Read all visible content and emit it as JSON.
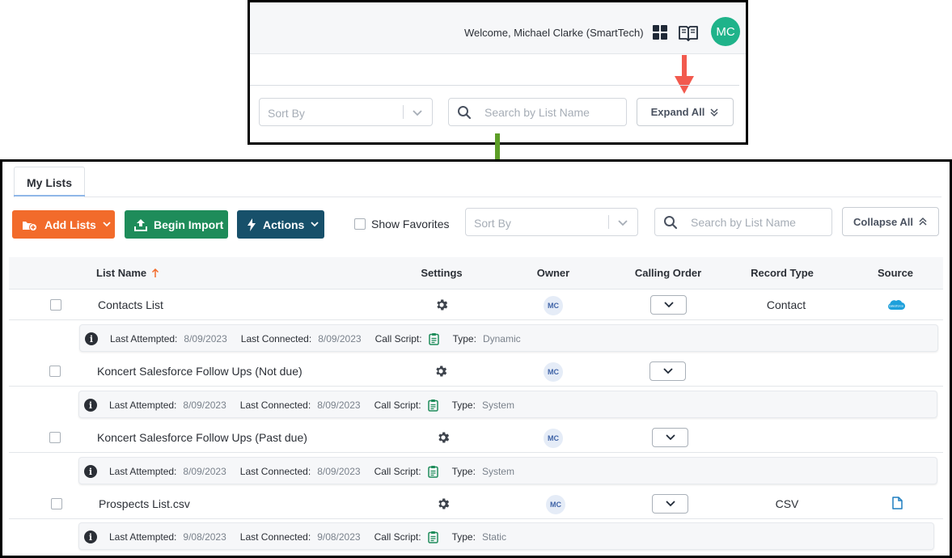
{
  "inset": {
    "welcome_text": "Welcome, Michael Clarke (SmartTech)",
    "avatar_initials": "MC",
    "sort_placeholder": "Sort By",
    "search_placeholder": "Search by List Name",
    "expand_all_label": "Expand All"
  },
  "main": {
    "tab_label": "My Lists",
    "add_lists_label": "Add Lists",
    "begin_import_label": "Begin Import",
    "actions_label": "Actions",
    "show_favorites_label": "Show Favorites",
    "sort_placeholder": "Sort By",
    "search_placeholder": "Search by List Name",
    "collapse_all_label": "Collapse All"
  },
  "table": {
    "columns": {
      "list_name": "List Name",
      "settings": "Settings",
      "owner": "Owner",
      "calling_order": "Calling Order",
      "record_type": "Record Type",
      "source": "Source"
    },
    "detail_labels": {
      "last_attempted": "Last Attempted:",
      "last_connected": "Last Connected:",
      "call_script": "Call Script:",
      "type": "Type:"
    },
    "rows": [
      {
        "name": "Contacts List",
        "owner": "MC",
        "record_type": "Contact",
        "source": "salesforce-cloud-icon",
        "last_attempted": "8/09/2023",
        "last_connected": "8/09/2023",
        "type": "Dynamic"
      },
      {
        "name": "Koncert Salesforce Follow Ups (Not due)",
        "owner": "MC",
        "record_type": "",
        "source": "",
        "last_attempted": "8/09/2023",
        "last_connected": "8/09/2023",
        "type": "System"
      },
      {
        "name": "Koncert Salesforce Follow Ups (Past due)",
        "owner": "MC",
        "record_type": "",
        "source": "",
        "last_attempted": "8/09/2023",
        "last_connected": "8/09/2023",
        "type": "System"
      },
      {
        "name": "Prospects List.csv",
        "owner": "MC",
        "record_type": "CSV",
        "source": "file-icon",
        "last_attempted": "9/08/2023",
        "last_connected": "9/08/2023",
        "type": "Static"
      }
    ]
  },
  "colors": {
    "add_lists": "#f26b2b",
    "begin_import": "#1e8c5a",
    "actions": "#17506a",
    "avatar": "#1fb38a",
    "red_arrow": "#f25a4e",
    "green_arrow": "#5d9e27",
    "call_script_icon": "#1e8c5a"
  }
}
